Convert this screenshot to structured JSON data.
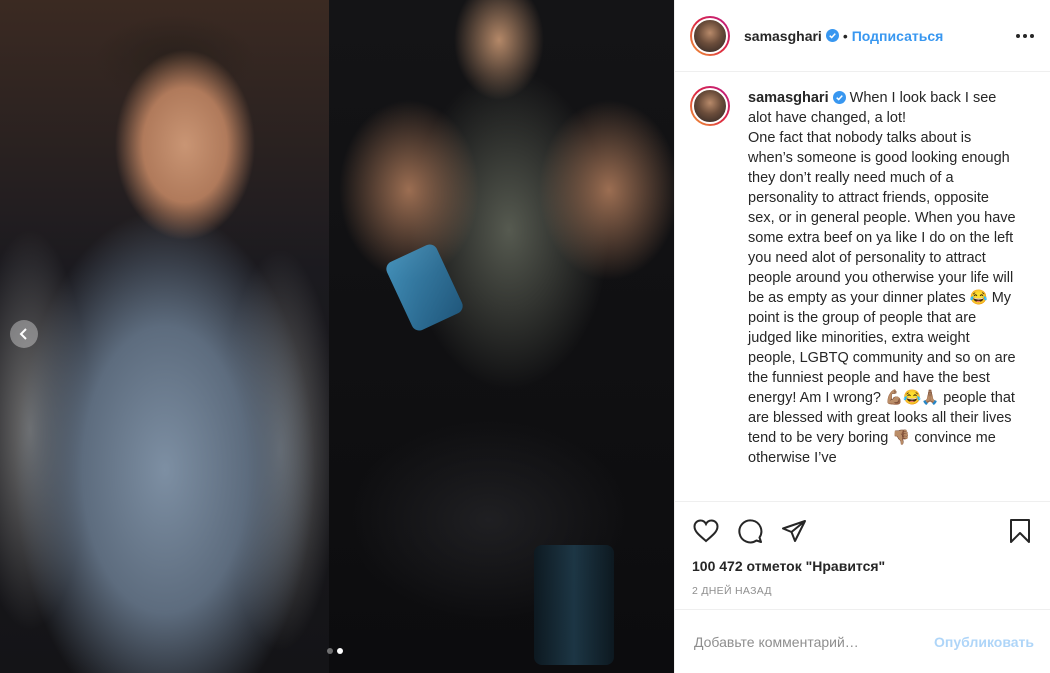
{
  "post": {
    "username": "samasghari",
    "follow_label": "Подписаться",
    "separator": "•",
    "caption_text": "When I look back I see alot have changed, a lot!\nOne fact that nobody talks about is when’s someone is good looking enough they don’t really need much of a personality to attract friends, opposite sex, or in general people. When you have some extra beef on ya like I do on the left you need alot of personality to attract people around you otherwise your life will be as empty as your dinner plates 😂 My point is the group of people that are judged like minorities, extra weight people, LGBTQ community and so on are the funniest people and have the best energy! Am I wrong? 💪🏽😂🙏🏽 people that are blessed with great looks all their lives tend to be very boring 👎🏽 convince me otherwise I’ve",
    "likes_text": "100 472 отметок \"Нравится\"",
    "timestamp": "2 ДНЕЙ НАЗАД",
    "comment_placeholder": "Добавьте комментарий…",
    "publish_label": "Опубликовать",
    "carousel_slides": 2,
    "carousel_active": 2
  },
  "colors": {
    "accent": "#3897f0",
    "verified": "#3897f0",
    "muted": "#8e8e8e"
  },
  "icons": [
    "chevron-left-icon",
    "verified-badge-icon",
    "more-options-icon",
    "heart-icon",
    "comment-icon",
    "share-icon",
    "bookmark-icon"
  ]
}
